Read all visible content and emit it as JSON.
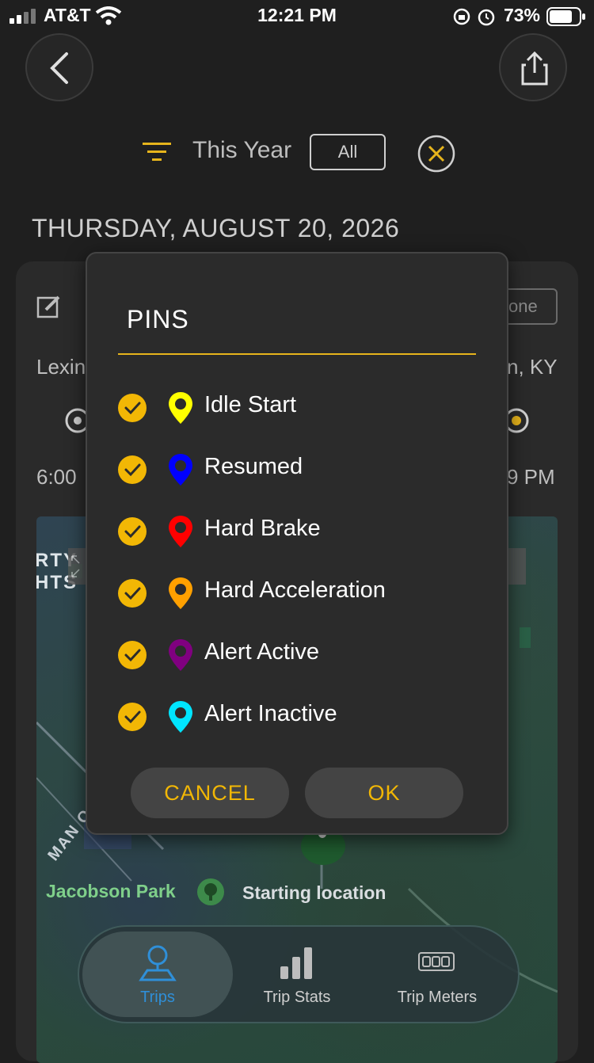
{
  "status": {
    "carrier": "AT&T",
    "time": "12:21 PM",
    "battery": "73%"
  },
  "filter": {
    "period": "This Year",
    "scope": "All"
  },
  "date_heading": "THURSDAY, AUGUST 20, 2026",
  "trip": {
    "start_city_partial": "Lexin",
    "end_city_partial": "n, KY",
    "start_time_partial": "6:00",
    "end_time_partial": "9 PM",
    "done_partial": "one"
  },
  "map": {
    "park": "Jacobson Park",
    "start_location": "Starting location",
    "road": "MAN O WAR BLVD"
  },
  "dialog": {
    "title": "PINS",
    "items": [
      {
        "label": "Idle Start",
        "color": "#ffff00"
      },
      {
        "label": "Resumed",
        "color": "#0000ff"
      },
      {
        "label": "Hard Brake",
        "color": "#ff0000"
      },
      {
        "label": "Hard Acceleration",
        "color": "#ffa000"
      },
      {
        "label": "Alert Active",
        "color": "#800080"
      },
      {
        "label": "Alert Inactive",
        "color": "#00e5ff"
      }
    ],
    "cancel": "CANCEL",
    "ok": "OK"
  },
  "nav": {
    "trips": "Trips",
    "stats": "Trip Stats",
    "meters": "Trip Meters"
  },
  "colors": {
    "accent": "#f2b705",
    "active_nav": "#2f8fd8"
  }
}
